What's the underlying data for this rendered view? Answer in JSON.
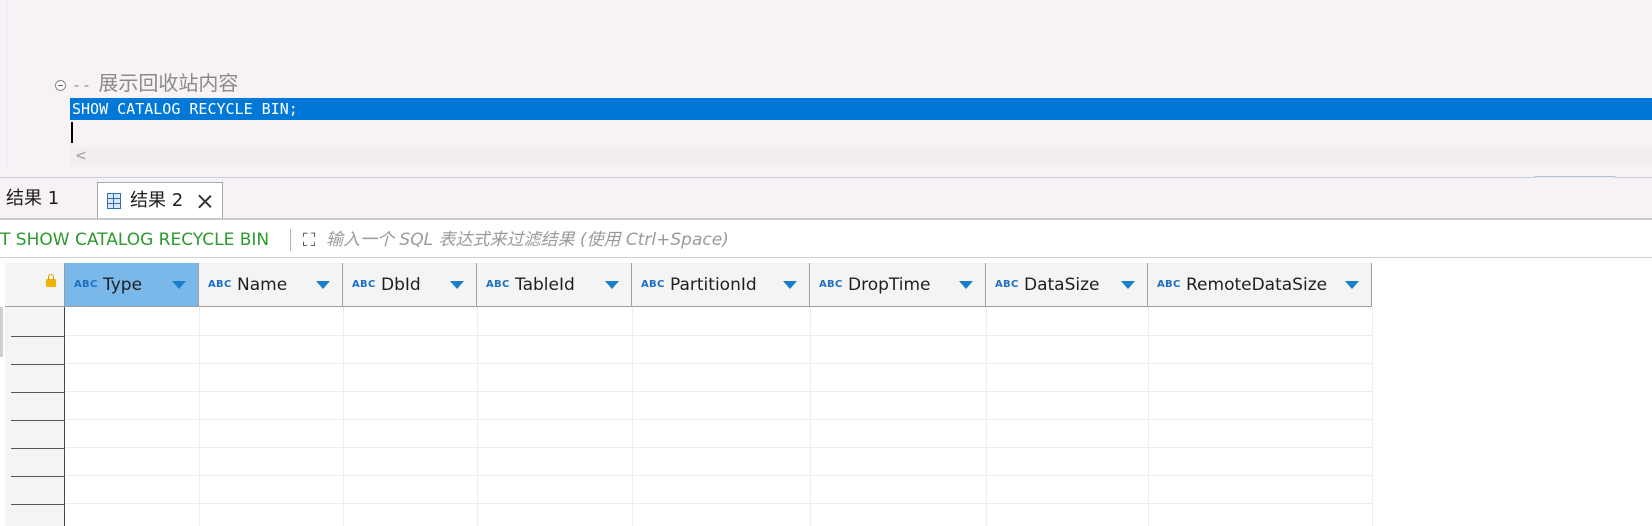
{
  "editor": {
    "comment_prefix": "--",
    "comment_text": " 展示回收站内容",
    "sql": "SHOW CATALOG RECYCLE BIN;"
  },
  "tabs": [
    {
      "label": "结果 1",
      "active": false
    },
    {
      "label": "结果 2",
      "active": true
    }
  ],
  "filter": {
    "query_label": "T SHOW CATALOG RECYCLE BIN",
    "placeholder": "输入一个 SQL 表达式来过滤结果 (使用 Ctrl+Space)"
  },
  "grid": {
    "type_badge": "ABC",
    "columns": [
      {
        "label": "Type",
        "selected": true
      },
      {
        "label": "Name",
        "selected": false
      },
      {
        "label": "DbId",
        "selected": false
      },
      {
        "label": "TableId",
        "selected": false
      },
      {
        "label": "PartitionId",
        "selected": false
      },
      {
        "label": "DropTime",
        "selected": false
      },
      {
        "label": "DataSize",
        "selected": false
      },
      {
        "label": "RemoteDataSize",
        "selected": false
      }
    ],
    "rows": []
  },
  "colors": {
    "selection": "#0078d7",
    "header_selected": "#7ab8ea",
    "query_label": "#2e9a2e",
    "sort_arrow": "#1a7fc8"
  }
}
